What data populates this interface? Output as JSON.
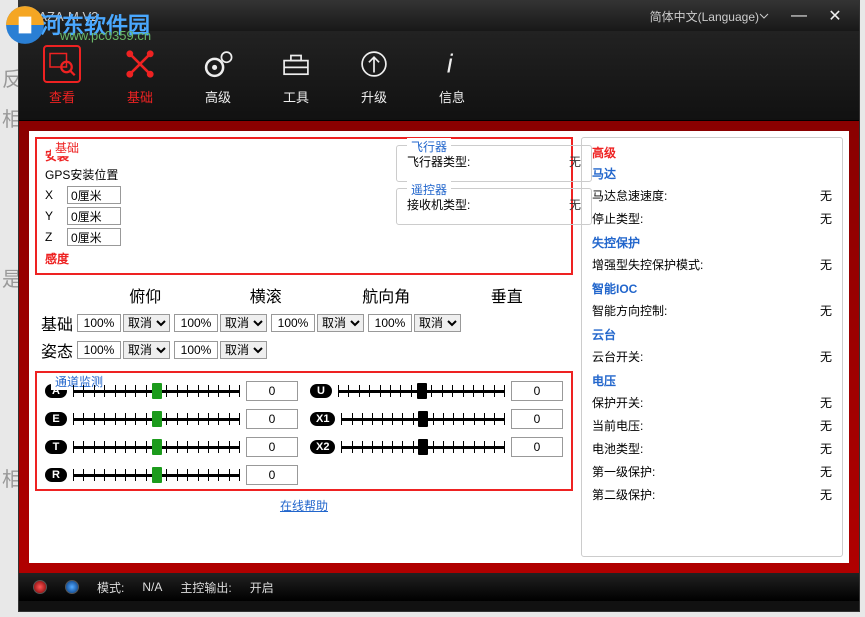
{
  "watermark_text": "河东软件园",
  "watermark_url": "www.pc0359.cn",
  "side_labels": [
    "反",
    "相",
    " ",
    "是",
    "相"
  ],
  "titlebar": {
    "app": "NAZA-M V2",
    "language": "简体中文(Language)"
  },
  "toolbar": {
    "view": "查看",
    "basic": "基础",
    "advanced": "高级",
    "tool": "工具",
    "upgrade": "升级",
    "info": "信息"
  },
  "basic": {
    "title": "基础",
    "install_title": "安装",
    "gps_label": "GPS安装位置",
    "x": "X",
    "y": "Y",
    "z": "Z",
    "xv": "0厘米",
    "yv": "0厘米",
    "zv": "0厘米",
    "sens_title": "感度",
    "head": {
      "pitch": "俯仰",
      "roll": "横滚",
      "yaw": "航向角",
      "vert": "垂直"
    },
    "rows": {
      "basic": "基础",
      "att": "姿态"
    },
    "cell": "100%",
    "cancel": "取消"
  },
  "aircraft": {
    "title": "飞行器",
    "type_label": "飞行器类型:",
    "type_val": "无"
  },
  "rc": {
    "title": "遥控器",
    "rx_label": "接收机类型:",
    "rx_val": "无"
  },
  "channel": {
    "title": "通道监测",
    "A": "A",
    "E": "E",
    "T": "T",
    "R": "R",
    "U": "U",
    "X1": "X1",
    "X2": "X2",
    "val": "0"
  },
  "help": "在线帮助",
  "adv": {
    "title": "高级",
    "motor": "马达",
    "motor_idle": "马达怠速速度:",
    "stop_type": "停止类型:",
    "failsafe": "失控保护",
    "enh": "增强型失控保护模式:",
    "ioc": "智能IOC",
    "ioc_dir": "智能方向控制:",
    "gimbal": "云台",
    "gimbal_sw": "云台开关:",
    "voltage": "电压",
    "prot_sw": "保护开关:",
    "cur_v": "当前电压:",
    "bat_type": "电池类型:",
    "lvl1": "第一级保护:",
    "lvl2": "第二级保护:",
    "none": "无"
  },
  "status": {
    "mode_label": "模式:",
    "mode_val": "N/A",
    "out_label": "主控输出:",
    "out_val": "开启"
  }
}
